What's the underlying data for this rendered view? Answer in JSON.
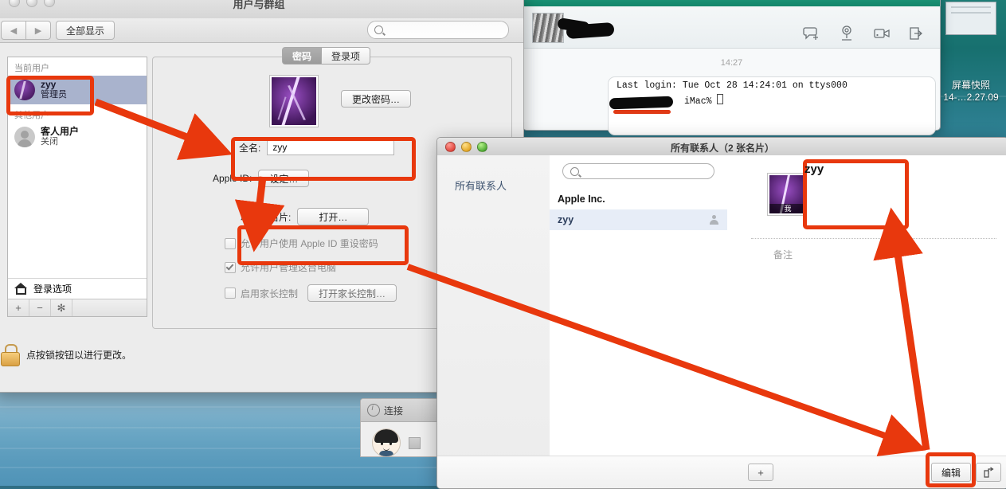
{
  "desktop": {
    "file_icon": {
      "label_line1": "屏幕快照",
      "label_line2": "14-…2.27.09",
      "icon": "screenshot-file-icon"
    }
  },
  "system_preferences": {
    "window_title": "用户与群组",
    "toolbar": {
      "back_icon": "chevron-left-icon",
      "forward_icon": "chevron-right-icon",
      "show_all_label": "全部显示",
      "search_icon": "search-icon",
      "search_placeholder": ""
    },
    "sidebar": {
      "group_current_label": "当前用户",
      "group_other_label": "其他用户",
      "current_user": {
        "name": "zyy",
        "role": "管理员"
      },
      "other_users": [
        {
          "name": "客人用户",
          "role": "关闭"
        }
      ],
      "login_options_label": "登录选项",
      "add_button": "+",
      "remove_button": "−",
      "settings_button": "✻"
    },
    "tabs": [
      {
        "label": "密码",
        "selected": true
      },
      {
        "label": "登录项",
        "selected": false
      }
    ],
    "panel": {
      "avatar": "user-avatar-lightning",
      "change_password_label": "更改密码…",
      "fullname_label": "全名:",
      "fullname_value": "zyy",
      "appleid_label": "Apple ID:",
      "appleid_button": "设定…",
      "contact_card_label": "联系人名片:",
      "contact_card_button": "打开…",
      "checkboxes": [
        {
          "label": "允许用户使用 Apple ID 重设密码",
          "checked": false
        },
        {
          "label": "允许用户管理这台电脑",
          "checked": true
        },
        {
          "label": "启用家长控制",
          "checked": false
        }
      ],
      "parental_button": "打开家长控制…"
    },
    "lock": {
      "icon": "lock-icon",
      "text": "点按锁按钮以进行更改。"
    }
  },
  "messages": {
    "avatar": "buddy-avatar",
    "name_redacted": true,
    "actions": [
      {
        "icon": "new-chat-icon"
      },
      {
        "icon": "screen-share-icon"
      },
      {
        "icon": "video-call-icon"
      },
      {
        "icon": "send-file-icon"
      }
    ],
    "timestamp": "14:27",
    "bubble": {
      "line1": "Last login: Tue Oct 28 14:24:01 on ttys000",
      "line2_suffix": "iMac% "
    }
  },
  "contacts": {
    "window_title": "所有联系人（2 张名片）",
    "sidebar_item": "所有联系人",
    "search_placeholder": "",
    "search_icon": "search-icon",
    "list": [
      {
        "name": "Apple Inc.",
        "style": "company",
        "icon": ""
      },
      {
        "name": "zyy",
        "style": "selected",
        "icon": "person-icon"
      }
    ],
    "detail": {
      "avatar_tag": "我",
      "name": "zyy",
      "notes_label": "备注"
    },
    "bottom": {
      "add_label": "+",
      "edit_label": "编辑",
      "share_icon": "share-icon"
    }
  },
  "back_window": {
    "info_icon": "info-icon",
    "title_partial": "连接",
    "avatar": "contact-face-avatar"
  },
  "annotations": {
    "color": "#e8380d",
    "boxes": [
      "sidebar-current-user-box",
      "fullname-row-box",
      "contact-card-row-box",
      "contacts-card-name-box",
      "contacts-edit-button-box"
    ],
    "arrows": [
      "arrow-sidebar-to-fullname",
      "arrow-fullname-to-contactcard",
      "arrow-contactcard-to-edit",
      "arrow-edit-to-cardname"
    ]
  }
}
